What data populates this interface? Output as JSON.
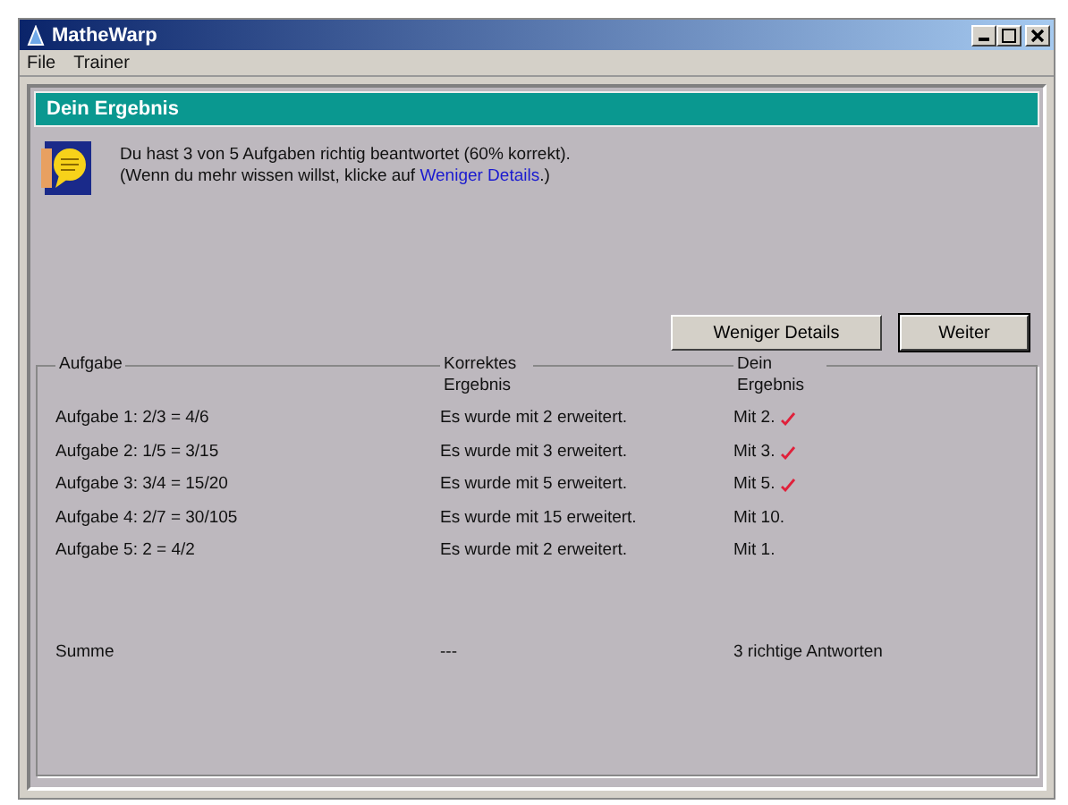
{
  "window": {
    "title": "MatheWarp"
  },
  "menu": [
    "File",
    "Trainer"
  ],
  "panel": {
    "title": "Dein Ergebnis",
    "summary": "Du hast 3 von 5 Aufgaben richtig beantwortet (60% korrekt).",
    "hint": "(Wenn du mehr wissen willst, klicke auf ",
    "hint_link": "Weniger Details",
    "hint_end": ".)"
  },
  "buttons": [
    {
      "label": "Weniger Details",
      "default": false
    },
    {
      "label": "Weiter",
      "default": true
    }
  ],
  "table": {
    "columns": [
      "Aufgabe",
      "Korrektes Ergebnis",
      "Dein Ergebnis"
    ],
    "rows": [
      {
        "task": "Aufgabe 1:  2/3 = 4/6",
        "correct_result": "Es wurde mit 2 erweitert.",
        "your_result": "Mit 2.",
        "correct": true
      },
      {
        "task": "Aufgabe 2:  1/5 = 3/15",
        "correct_result": "Es wurde mit 3 erweitert.",
        "your_result": "Mit 3.",
        "correct": true
      },
      {
        "task": "Aufgabe 3:  3/4 = 15/20",
        "correct_result": "Es wurde mit 5 erweitert.",
        "your_result": "Mit 5.",
        "correct": true
      },
      {
        "task": "Aufgabe 4:  2/7 = 30/105",
        "correct_result": "Es wurde mit 15 erweitert.",
        "your_result": "Mit 10.",
        "correct": false
      },
      {
        "task": "Aufgabe 5:  2 = 4/2",
        "correct_result": "Es wurde mit 2 erweitert.",
        "your_result": "Mit 1.",
        "correct": false
      }
    ],
    "total": {
      "task": "Summe",
      "correct_result": "---",
      "your_result": "3 richtige Antworten"
    }
  }
}
